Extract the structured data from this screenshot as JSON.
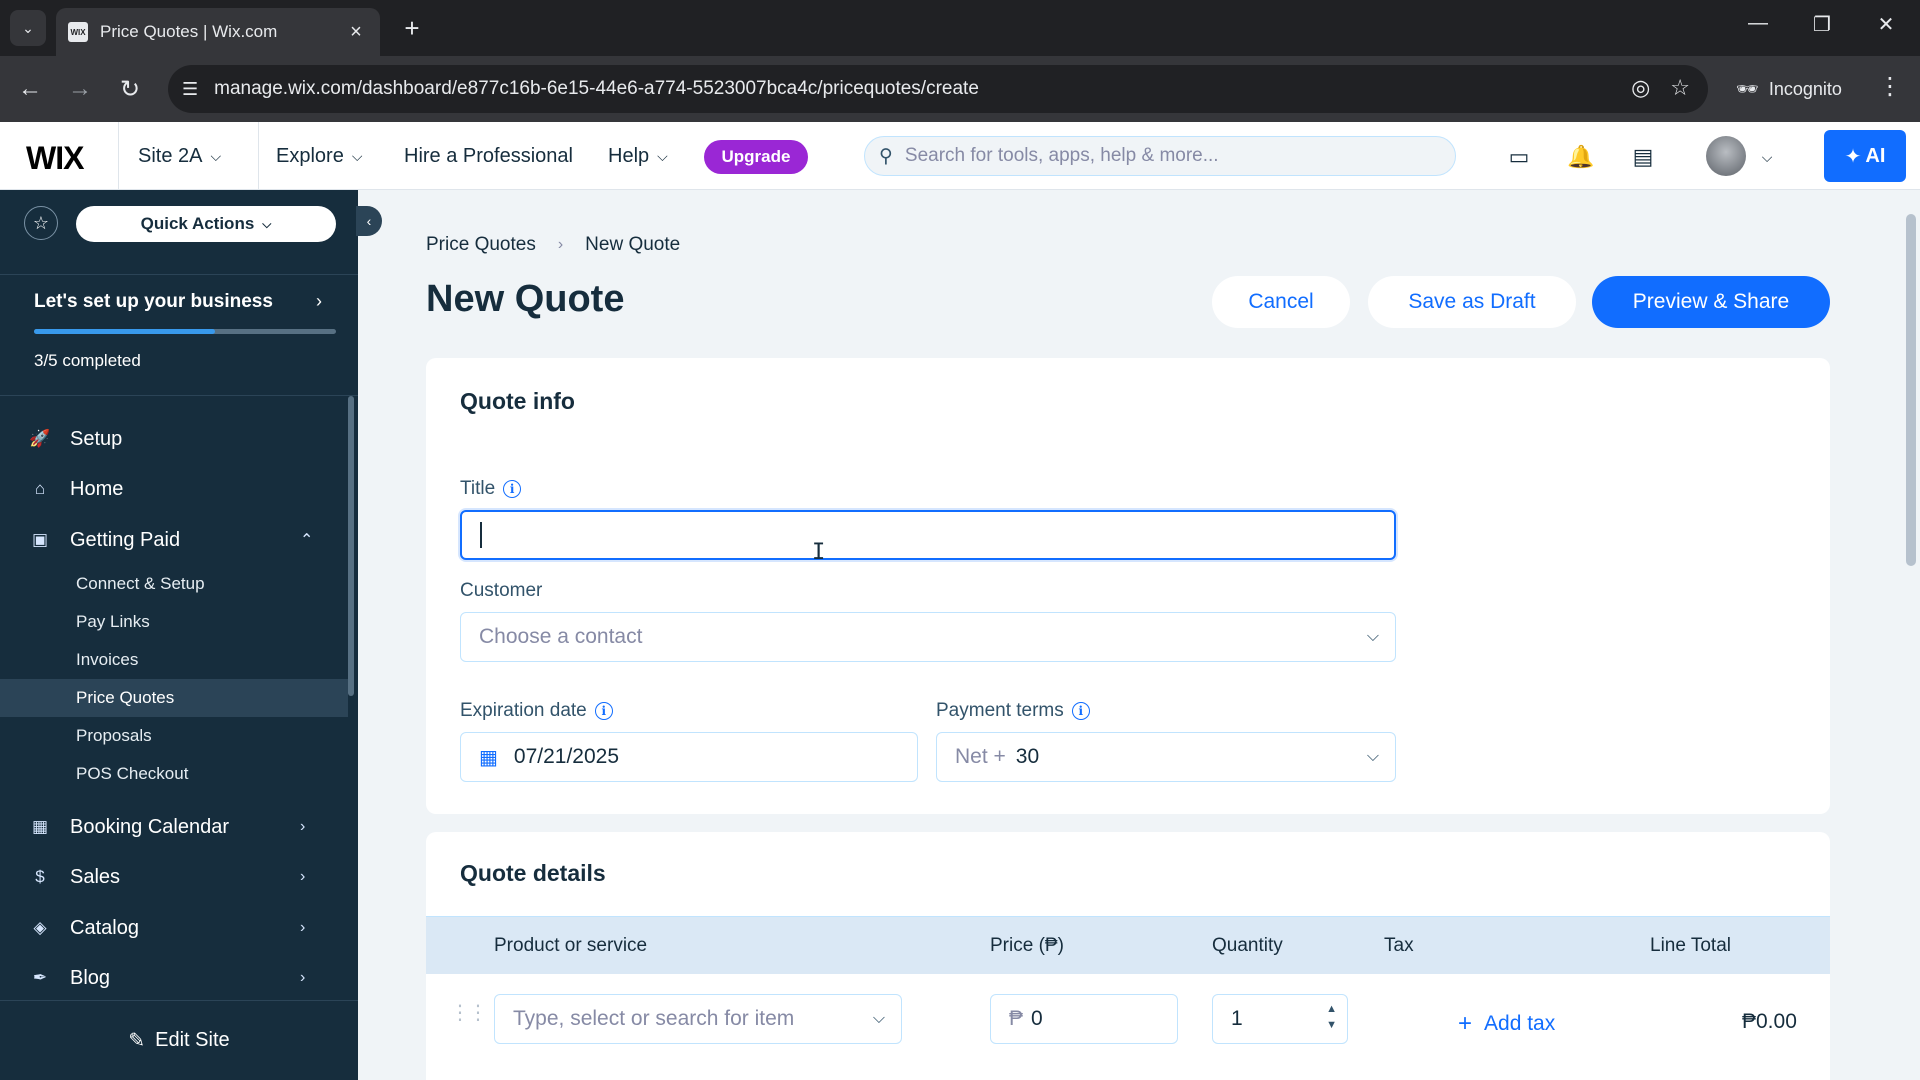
{
  "browser": {
    "tab_title": "Price Quotes | Wix.com",
    "favicon_text": "WIX",
    "url": "manage.wix.com/dashboard/e877c16b-6e15-44e6-a774-5523007bca4c/pricequotes/create",
    "incognito_label": "Incognito"
  },
  "topbar": {
    "logo": "WIX",
    "site_name": "Site 2A",
    "explore": "Explore",
    "hire": "Hire a Professional",
    "help": "Help",
    "upgrade": "Upgrade",
    "search_placeholder": "Search for tools, apps, help & more...",
    "ai_label": "AI"
  },
  "sidebar": {
    "quick_actions": "Quick Actions",
    "setup_title": "Let's set up your business",
    "setup_status": "3/5 completed",
    "setup_progress": 0.6,
    "items": {
      "setup": "Setup",
      "home": "Home",
      "getting_paid": "Getting Paid",
      "booking_calendar": "Booking Calendar",
      "sales": "Sales",
      "catalog": "Catalog",
      "blog": "Blog"
    },
    "sub_items": {
      "connect_setup": "Connect & Setup",
      "pay_links": "Pay Links",
      "invoices": "Invoices",
      "price_quotes": "Price Quotes",
      "proposals": "Proposals",
      "pos_checkout": "POS Checkout"
    },
    "edit_site": "Edit Site"
  },
  "page": {
    "breadcrumb": [
      "Price Quotes",
      "New Quote"
    ],
    "title": "New Quote",
    "cancel": "Cancel",
    "save_draft": "Save as Draft",
    "preview_share": "Preview & Share"
  },
  "quote_info": {
    "heading": "Quote info",
    "title_label": "Title",
    "title_value": "",
    "customer_label": "Customer",
    "customer_placeholder": "Choose a contact",
    "expiration_label": "Expiration date",
    "expiration_value": "07/21/2025",
    "payment_terms_label": "Payment terms",
    "payment_terms_prefix": "Net +",
    "payment_terms_value": "30"
  },
  "quote_details": {
    "heading": "Quote details",
    "columns": [
      "Product or service",
      "Price (₱)",
      "Quantity",
      "Tax",
      "Line Total"
    ],
    "row": {
      "item_placeholder": "Type, select or search for item",
      "currency_symbol": "₱",
      "price": "0",
      "quantity": "1",
      "add_tax": "Add tax",
      "line_total": "₱0.00"
    }
  }
}
